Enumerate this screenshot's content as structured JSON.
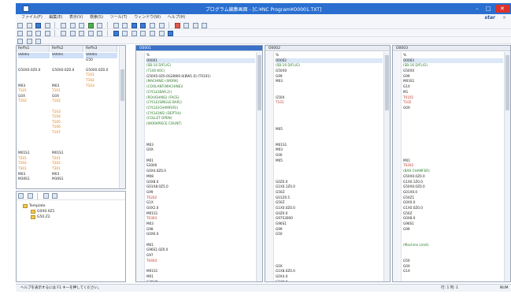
{
  "window": {
    "title": "プログラム編集画面 - [C:¥NC Program¥O0001.TXT]",
    "minimize": "–",
    "maximize": "□",
    "close": "✕"
  },
  "menu": {
    "items": [
      "ファイル(F)",
      "編集(E)",
      "表示(V)",
      "検索(S)",
      "ツール(T)",
      "ウィンドウ(W)",
      "ヘルプ(H)"
    ],
    "brand": "star",
    "close": "×"
  },
  "file_panel": {
    "columns": [
      {
        "header": "Ref%1",
        "items": [
          "O0001",
          "",
          "",
          "G50X0.0Z0.0",
          "",
          "",
          "M03",
          "T101",
          "G0X",
          "T102",
          "",
          "",
          "",
          "",
          "",
          "",
          "",
          "",
          "",
          "M01S1",
          "T201",
          "T202",
          "T301",
          "M03",
          "M30S1"
        ]
      },
      {
        "header": "Ref%2",
        "items": [
          "O0001",
          "",
          "",
          "G50X0.0Z0.0",
          "",
          "",
          "M03",
          "T101",
          "G0X",
          "T102",
          "",
          "T103",
          "T104",
          "T105",
          "T106",
          "T107",
          "",
          "",
          "",
          "M01S1",
          "T201",
          "T202",
          "T301",
          "M03",
          "M30S1"
        ]
      },
      {
        "header": "Ref%3",
        "items": [
          "O0001",
          "G50",
          "",
          "G50X0.0Z0.0",
          "T101",
          "T102",
          "T103",
          "",
          "",
          "",
          "",
          "",
          "",
          "",
          "",
          "",
          "",
          "",
          "",
          "",
          "",
          "",
          "",
          "",
          ""
        ]
      }
    ]
  },
  "tree": {
    "root": "Template",
    "children": [
      "G0X0.0Z1",
      "G50.Z2"
    ]
  },
  "panes": [
    {
      "header": "O0001",
      "lines": [
        "%",
        "O0001",
        "(SB-16 D/FL/G)",
        "(T100 K0C)",
        "G50X0.0Z0.0G28W0.0(BW1.0) (T0101)",
        "(MACHINE) (WORK)",
        "(COOLANT(MACHINE))",
        "(CYCLE(BAR.2))",
        "(ROUGHING) (FACE)",
        "(CYCLE(SINGLE BAR))",
        "(CYCLE(CHAMFER))",
        "(CYCLE(NS) (DEPTH))",
        "(COLLET OPEN)",
        "(WORKPIECE COUNT)",
        "",
        "",
        "",
        "M03",
        "G0X",
        "",
        "M01",
        "S3000",
        "G0X4.0Z0.0",
        "M08",
        "G0X8.0",
        "G01X8.0Z5.0",
        "G99",
        "T0202",
        "G1X",
        "G0X2.0",
        "M01S1",
        "T0303",
        "M03",
        "G98",
        "G0X6.0",
        "",
        "M01",
        "G96S1.0Z0.0",
        "G97",
        "T0404",
        "",
        "M01S1",
        "M01",
        "G28U0",
        "M30",
        "%"
      ]
    },
    {
      "header": "O0002",
      "lines": [
        "%",
        "O0002",
        "(SB-16 D/FL/G)",
        "G50X0",
        "G99",
        "M03",
        "",
        "",
        "G50X",
        "T101",
        "",
        "",
        "",
        "",
        "M05",
        "",
        "",
        "M01S1",
        "M03",
        "G00",
        "M05",
        "",
        "",
        "",
        "G0Z0.0",
        "G1X0.1Z0.0",
        "G50Z",
        "G01Z0.5",
        "G50Z",
        "G1X0.0Z0.0",
        "G0Z0.0",
        "G97S3000",
        "G96S1",
        "G99",
        "G50",
        "",
        "",
        "",
        "",
        "",
        "G0X",
        "G1X8.0Z0.0",
        "G0X4.0",
        "G1X0.0",
        "G1Z0.0",
        "G28U0"
      ]
    },
    {
      "header": "O0003",
      "lines": [
        "%",
        "O0003",
        "(SB-16 D/FL/G)",
        "G50X0",
        "G99",
        "M03S1",
        "G1X",
        "M1",
        "T0101",
        "T102",
        "G0X",
        "",
        "",
        "",
        "",
        "",
        "",
        "",
        "",
        "",
        "M01",
        "T0202",
        "(BAR CHAMFER)",
        "G50X0.0Z0.0",
        "G1X0.1Z0.0",
        "G50X0.0Z0.0",
        "G01X0.0",
        "G50Z1",
        "G0X0.0",
        "G1X0.0Z0.0",
        "G50Z",
        "G0X8.0",
        "G96S1",
        "G99",
        "",
        "",
        "(Machine Limit)",
        "",
        "",
        "G50",
        "G0X",
        "G1X",
        "",
        "",
        "",
        ""
      ]
    }
  ],
  "status": {
    "message": "ヘルプを表示するには F1 キーを押してください。",
    "position": "行: 1 列: 1",
    "mode": "NUM"
  }
}
